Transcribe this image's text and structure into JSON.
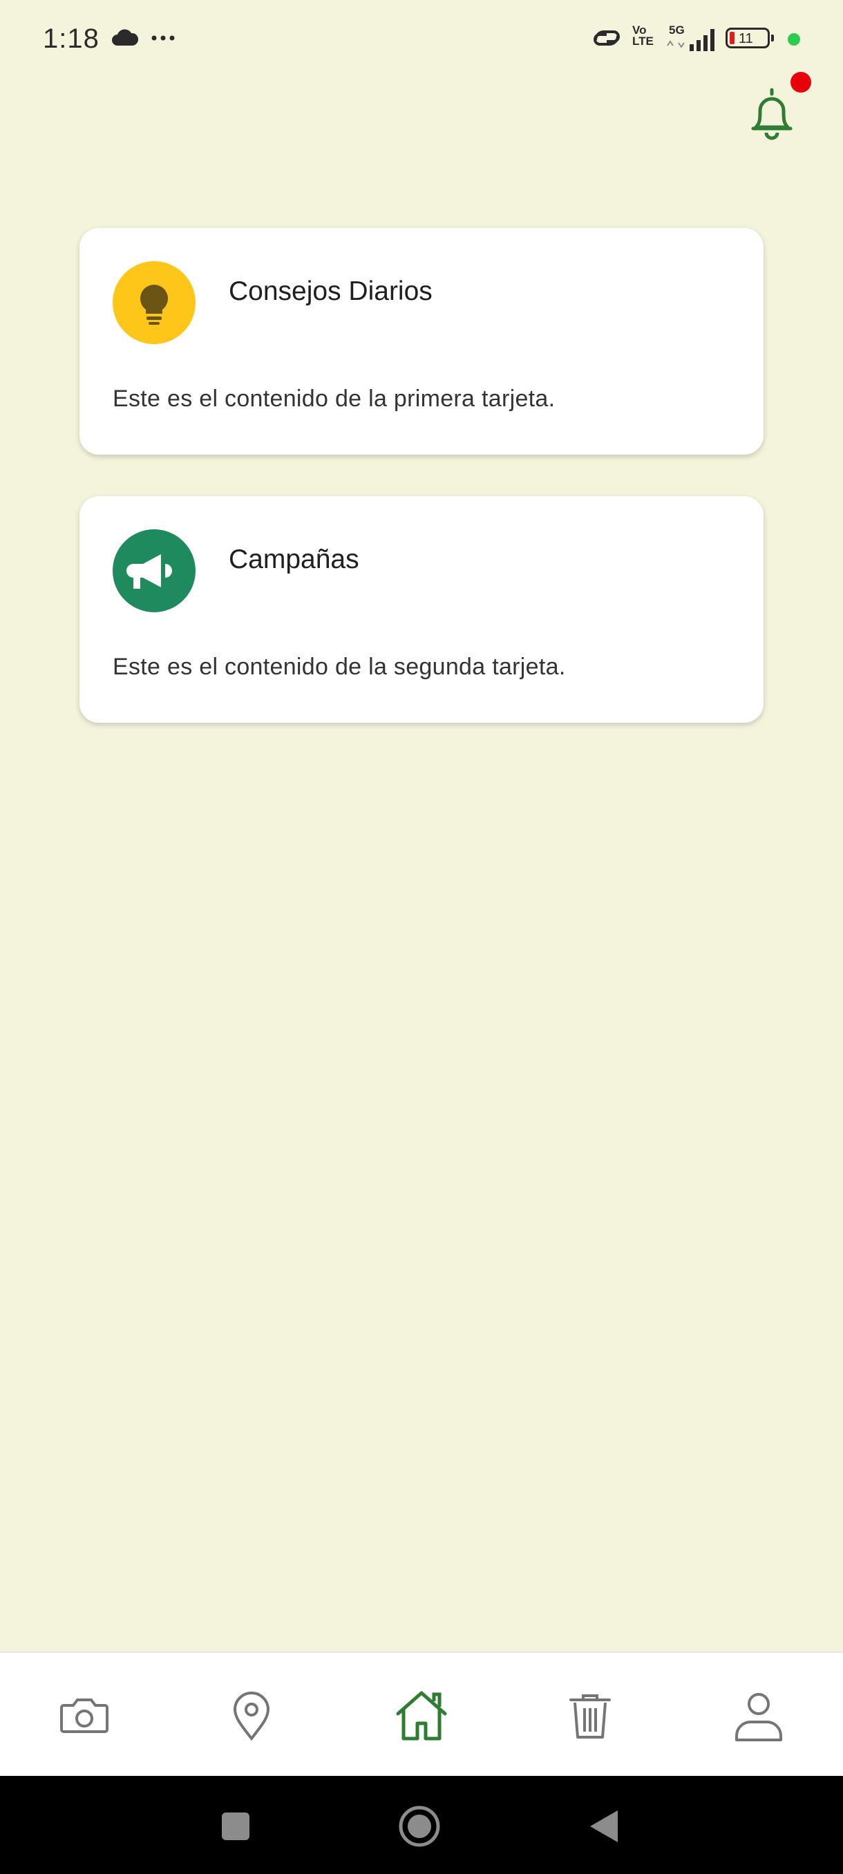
{
  "status_bar": {
    "time": "1:18",
    "network_volte": "Vo\nLTE",
    "network_5g": "5G",
    "battery_level": "11",
    "icons": [
      "cloud-icon",
      "more-dots-icon",
      "hotspot-icon",
      "signal-icon",
      "battery-icon"
    ]
  },
  "header": {
    "notification_icon": "bell-icon",
    "has_unread_badge": true,
    "badge_color": "#E8000B"
  },
  "cards": [
    {
      "title": "Consejos Diarios",
      "body": "Este es el contenido de la primera tarjeta.",
      "icon": "lightbulb-icon",
      "icon_bg": "#FFC61A"
    },
    {
      "title": "Campañas",
      "body": "Este es el contenido de la segunda tarjeta.",
      "icon": "megaphone-icon",
      "icon_bg": "#1F8A5E"
    }
  ],
  "bottom_nav": {
    "items": [
      {
        "icon": "camera-icon",
        "active": false
      },
      {
        "icon": "location-pin-icon",
        "active": false
      },
      {
        "icon": "home-icon",
        "active": true
      },
      {
        "icon": "trash-icon",
        "active": false
      },
      {
        "icon": "user-icon",
        "active": false
      }
    ],
    "active_color": "#2E7D32",
    "inactive_color": "#757575"
  },
  "colors": {
    "background": "#F4F4DC",
    "accent": "#2E7D32"
  }
}
